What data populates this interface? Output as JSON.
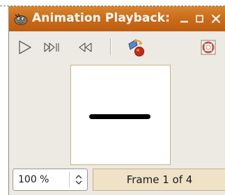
{
  "window": {
    "title": "Animation Playback:",
    "app_icon": "gimp-wilber-icon",
    "controls": [
      "minimize-icon",
      "maximize-icon",
      "close-icon"
    ]
  },
  "toolbar": {
    "buttons": [
      {
        "name": "play",
        "icon": "play-icon"
      },
      {
        "name": "step",
        "icon": "step-forward-icon"
      },
      {
        "name": "rewind",
        "icon": "rewind-icon"
      },
      {
        "name": "detach",
        "icon": "detach-icon"
      },
      {
        "name": "help",
        "icon": "lifebuoy-help-icon"
      }
    ]
  },
  "status": {
    "zoom_value": "100 %",
    "frame_label": "Frame 1 of 4"
  },
  "colors": {
    "titlebar": "#cc6d1b",
    "window_bg": "#edeae3",
    "frame_field_bg": "#efe2c7",
    "canvas_bg": "#ffffff",
    "stroke": "#000000"
  }
}
